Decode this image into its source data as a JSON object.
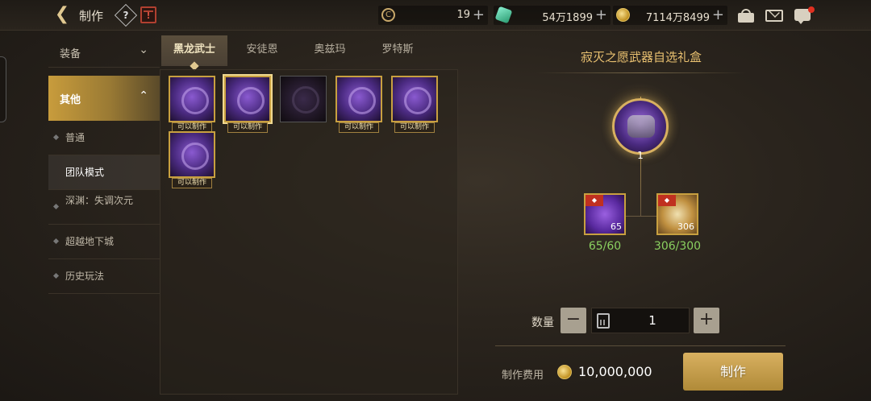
{
  "header": {
    "title": "制作",
    "help_label": "?",
    "currencies": [
      {
        "icon": "cera-icon",
        "value": "19",
        "color": "#c8a86a"
      },
      {
        "icon": "crystal-icon",
        "value": "54万1899",
        "color": "#4ad0a0"
      },
      {
        "icon": "gold-coin-icon",
        "value": "7114万8499",
        "color": "#e0b040"
      }
    ]
  },
  "sidebar": {
    "categories": [
      {
        "label": "装备",
        "chevron": "⌄"
      },
      {
        "label": "其他",
        "chevron": "⌃"
      }
    ],
    "items": [
      {
        "label": "普通"
      },
      {
        "label": "团队模式"
      },
      {
        "label": "深渊：失调次元"
      },
      {
        "label": "超越地下城"
      },
      {
        "label": "历史玩法"
      }
    ]
  },
  "tabs": [
    {
      "label": "黑龙武士"
    },
    {
      "label": "安徒恩"
    },
    {
      "label": "奥兹玛"
    },
    {
      "label": "罗特斯"
    }
  ],
  "items": [
    {
      "tag": "可以制作",
      "available": true
    },
    {
      "tag": "可以制作",
      "available": true
    },
    {
      "tag": "",
      "available": false
    },
    {
      "tag": "可以制作",
      "available": true
    },
    {
      "tag": "可以制作",
      "available": true
    },
    {
      "tag": "可以制作",
      "available": true
    }
  ],
  "detail": {
    "title": "寂灭之愿武器自选礼盒",
    "result_count": "1",
    "materials": [
      {
        "count": "65",
        "ratio": "65/60",
        "badge": "◆"
      },
      {
        "count": "306",
        "ratio": "306/300",
        "badge": "◆"
      }
    ],
    "quantity_label": "数量",
    "quantity": "1",
    "minus": "−",
    "plus": "+",
    "cost_label": "制作费用",
    "cost_value": "10,000,000",
    "craft_label": "制作"
  }
}
